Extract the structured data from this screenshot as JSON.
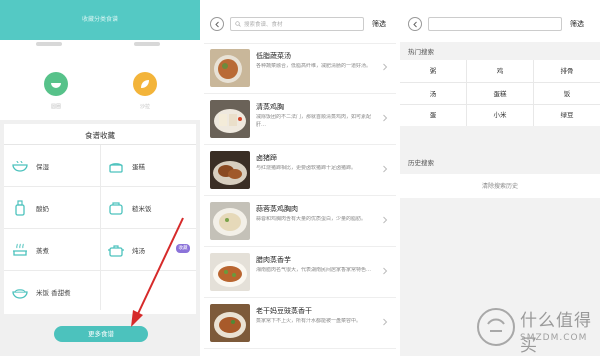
{
  "panel1": {
    "header_title": "收藏分类食谱",
    "circle_left_label": "圆圈",
    "circle_right_label": "沙拉",
    "section_title": "食谱收藏",
    "categories": [
      {
        "label": "保湿",
        "icon": "bowl-icon"
      },
      {
        "label": "蛋糕",
        "icon": "cake-icon"
      },
      {
        "label": "酸奶",
        "icon": "bottle-icon"
      },
      {
        "label": "糙米饭",
        "icon": "rice-cooker-icon"
      },
      {
        "label": "蒸煮",
        "icon": "steam-pot-icon"
      },
      {
        "label": "炖汤",
        "icon": "stew-pot-icon"
      },
      {
        "label": "米饭 香甜煮",
        "icon": "rice-bowl-icon"
      }
    ],
    "badge": "收藏",
    "more_button": "更多食谱",
    "colors": {
      "header": "#54c9c4",
      "accent": "#4cc2bd",
      "badge": "#8b73d9",
      "arrow": "#d62a2a",
      "circle_left": "#57c28a",
      "circle_right": "#f3b43a"
    }
  },
  "panel2": {
    "search_placeholder": "搜索食谱、食材",
    "filter_label": "筛选",
    "recipes": [
      {
        "title": "低脂蔬菜汤",
        "desc": "各种蔬菜融合，低脂高纤维，减肥清肠的一道好汤。"
      },
      {
        "title": "清蒸鸡胸",
        "desc": "减除饭团的不二法门，那就首顺清蒸鸡肉，如可素配肝…"
      },
      {
        "title": "卤猪蹄",
        "desc": "与红烧猪蹄相比，更要卤软猪蹄十足卤猪蹄。"
      },
      {
        "title": "蒜蓉蒸鸡胸肉",
        "desc": "蒜蓉和鸡胸肉含有大量的优质蛋白，少量的脂肪。"
      },
      {
        "title": "腊肉蒸香芋",
        "desc": "湘南腊肉名气很大，代表湖南民间居家香家常特色…"
      },
      {
        "title": "老干妈豆豉蒸香干",
        "desc": "蒸家常下不上火，所有汁水都能被一盘菜容中。"
      }
    ]
  },
  "panel3": {
    "filter_label": "筛选",
    "hot_title": "热门搜索",
    "hot_items": [
      "粥",
      "鸡",
      "排骨",
      "汤",
      "蛋糕",
      "饭",
      "蛋",
      "小米",
      "绿豆"
    ],
    "history_title": "历史搜索",
    "clear_history": "清除搜索历史"
  },
  "watermark": {
    "line1": "什么值得买",
    "line2": "SMZDM.COM"
  }
}
